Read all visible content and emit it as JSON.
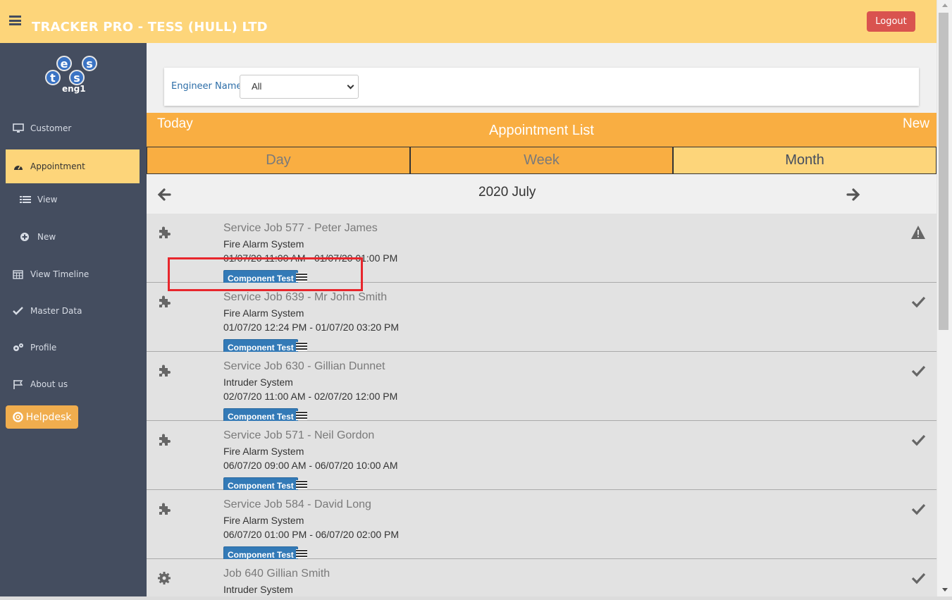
{
  "header": {
    "title": "TRACKER PRO - TESS (HULL) LTD",
    "logout_label": "Logout"
  },
  "sidebar": {
    "logo_letters": [
      "t",
      "e",
      "s",
      "s"
    ],
    "user": "eng1",
    "items": [
      {
        "label": "Customer",
        "icon": "monitor-icon"
      },
      {
        "label": "Appointment",
        "icon": "dashboard-icon",
        "active": true
      },
      {
        "label": "View",
        "icon": "list-icon"
      },
      {
        "label": "New",
        "icon": "plus-circle-icon"
      },
      {
        "label": "View Timeline",
        "icon": "calendar-icon"
      },
      {
        "label": "Master Data",
        "icon": "check-icon"
      },
      {
        "label": "Profile",
        "icon": "gears-icon"
      },
      {
        "label": "About us",
        "icon": "flag-icon"
      }
    ],
    "helpdesk_label": "Helpdesk"
  },
  "filter": {
    "label": "Engineer Name",
    "selected": "All"
  },
  "appointments": {
    "today_label": "Today",
    "title": "Appointment List",
    "new_label": "New",
    "tabs": [
      {
        "label": "Day",
        "active": false
      },
      {
        "label": "Week",
        "active": false
      },
      {
        "label": "Month",
        "active": true
      }
    ],
    "month_label": "2020 July",
    "rows": [
      {
        "title": "Service Job 577 - Peter James",
        "system": "Fire Alarm System",
        "time": "01/07/20 11:00 AM - 01/07/20 01:00 PM",
        "tag": "Component Test",
        "status": "warning",
        "icon": "puzzle-icon"
      },
      {
        "title": "Service Job 639 - Mr John Smith",
        "system": "Fire Alarm System",
        "time": "01/07/20 12:24 PM - 01/07/20 03:20 PM",
        "tag": "Component Test",
        "status": "done",
        "icon": "puzzle-icon"
      },
      {
        "title": "Service Job 630 - Gillian Dunnet",
        "system": "Intruder System",
        "time": "02/07/20 11:00 AM - 02/07/20 12:00 PM",
        "tag": "Component Test",
        "status": "done",
        "icon": "puzzle-icon"
      },
      {
        "title": "Service Job 571 - Neil Gordon",
        "system": "Fire Alarm System",
        "time": "06/07/20 09:00 AM - 06/07/20 10:00 AM",
        "tag": "Component Test",
        "status": "done",
        "icon": "puzzle-icon"
      },
      {
        "title": "Service Job 584 - David Long",
        "system": "Fire Alarm System",
        "time": "06/07/20 01:00 PM - 06/07/20 02:00 PM",
        "tag": "Component Test",
        "status": "done",
        "icon": "puzzle-icon"
      },
      {
        "title": "Job 640 Gillian Smith",
        "system": "Intruder System",
        "time": "",
        "tag": "",
        "status": "done",
        "icon": "gear-icon"
      }
    ]
  },
  "colors": {
    "header_bg": "#fdd57a",
    "sidebar_bg": "#444d5f",
    "accent_orange": "#f9ae42",
    "tag_blue": "#337ab7",
    "logout_red": "#d9534f",
    "highlight_red": "#e8262c"
  }
}
